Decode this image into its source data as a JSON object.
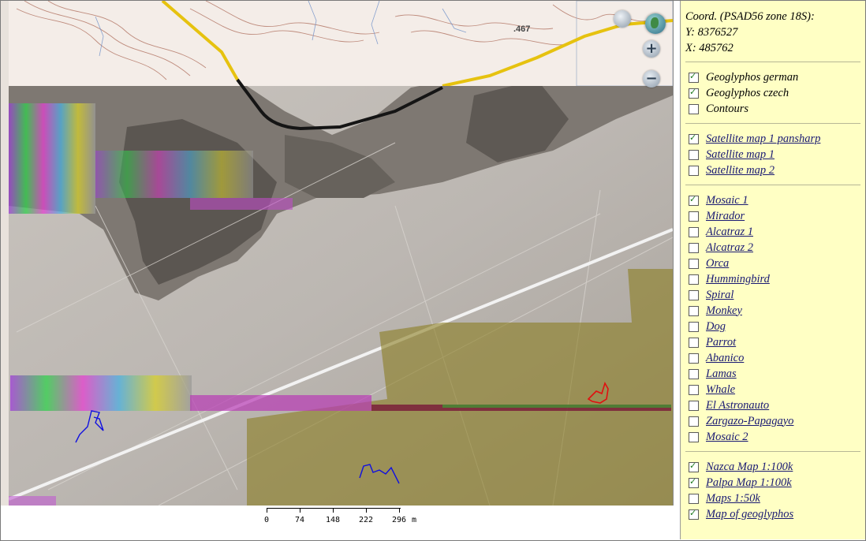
{
  "map": {
    "spot_height": ".467",
    "scale": {
      "ticks": [
        "0",
        "74",
        "148",
        "222",
        "296"
      ],
      "unit": "m"
    }
  },
  "panel": {
    "coord_title": "Coord. (PSAD56 zone 18S):",
    "coord_y": "Y: 8376527",
    "coord_x": "X: 485762",
    "group1": [
      {
        "label": "Geoglyphos german",
        "checked": true,
        "link": false
      },
      {
        "label": "Geoglyphos czech",
        "checked": true,
        "link": false
      },
      {
        "label": "Contours",
        "checked": false,
        "link": false
      }
    ],
    "group2": [
      {
        "label": "Satellite map 1 pansharp",
        "checked": true,
        "link": true
      },
      {
        "label": "Satellite map 1",
        "checked": false,
        "link": true
      },
      {
        "label": "Satellite map 2",
        "checked": false,
        "link": true
      }
    ],
    "group3": [
      {
        "label": "Mosaic 1",
        "checked": true,
        "link": true
      },
      {
        "label": "Mirador",
        "checked": false,
        "link": true
      },
      {
        "label": "Alcatraz 1",
        "checked": false,
        "link": true
      },
      {
        "label": "Alcatraz 2",
        "checked": false,
        "link": true
      },
      {
        "label": "Orca",
        "checked": false,
        "link": true
      },
      {
        "label": "Hummingbird",
        "checked": false,
        "link": true
      },
      {
        "label": "Spiral",
        "checked": false,
        "link": true
      },
      {
        "label": "Monkey",
        "checked": false,
        "link": true
      },
      {
        "label": "Dog",
        "checked": false,
        "link": true
      },
      {
        "label": "Parrot",
        "checked": false,
        "link": true
      },
      {
        "label": "Abanico",
        "checked": false,
        "link": true
      },
      {
        "label": "Lamas",
        "checked": false,
        "link": true
      },
      {
        "label": "Whale",
        "checked": false,
        "link": true
      },
      {
        "label": "El Astronauto",
        "checked": false,
        "link": true
      },
      {
        "label": "Zargazo-Papagayo",
        "checked": false,
        "link": true
      },
      {
        "label": "Mosaic 2",
        "checked": false,
        "link": true
      }
    ],
    "group4": [
      {
        "label": "Nazca Map 1:100k",
        "checked": true,
        "link": true
      },
      {
        "label": "Palpa Map 1:100k",
        "checked": true,
        "link": true
      },
      {
        "label": "Maps 1:50k",
        "checked": false,
        "link": true
      },
      {
        "label": "Map of geoglyphos",
        "checked": true,
        "link": true
      }
    ]
  },
  "colors": {
    "panel_bg": "#ffffc4",
    "overlay": "#8a7d22",
    "road": "#e6c20f",
    "geoglyph_blue": "#1010e0",
    "geoglyph_red": "#e01010"
  }
}
